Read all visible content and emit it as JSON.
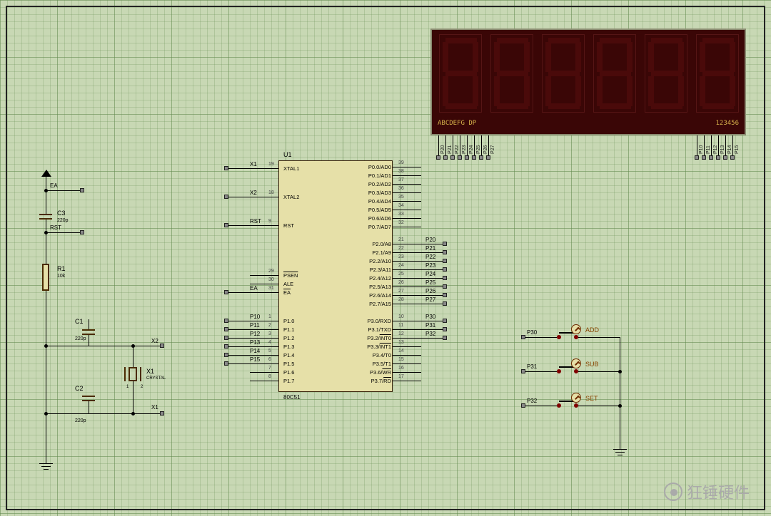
{
  "watermark": "狂锤硬件",
  "ic": {
    "ref": "U1",
    "part": "80C51",
    "pins_left": [
      {
        "n": "19",
        "name": "XTAL1",
        "net": "X1"
      },
      {
        "n": "18",
        "name": "XTAL2",
        "net": "X2"
      },
      {
        "n": "9",
        "name": "RST",
        "net": "RST"
      },
      {
        "n": "29",
        "name": "PSEN",
        "ov": true
      },
      {
        "n": "30",
        "name": "ALE"
      },
      {
        "n": "31",
        "name": "EA",
        "ov": true,
        "net": "EA"
      },
      {
        "n": "1",
        "name": "P1.0",
        "net": "P10"
      },
      {
        "n": "2",
        "name": "P1.1",
        "net": "P11"
      },
      {
        "n": "3",
        "name": "P1.2",
        "net": "P12"
      },
      {
        "n": "4",
        "name": "P1.3",
        "net": "P13"
      },
      {
        "n": "5",
        "name": "P1.4",
        "net": "P14"
      },
      {
        "n": "6",
        "name": "P1.5",
        "net": "P15"
      },
      {
        "n": "7",
        "name": "P1.6"
      },
      {
        "n": "8",
        "name": "P1.7"
      }
    ],
    "pins_right": [
      {
        "n": "39",
        "name": "P0.0/AD0"
      },
      {
        "n": "38",
        "name": "P0.1/AD1"
      },
      {
        "n": "37",
        "name": "P0.2/AD2"
      },
      {
        "n": "36",
        "name": "P0.3/AD3"
      },
      {
        "n": "35",
        "name": "P0.4/AD4"
      },
      {
        "n": "34",
        "name": "P0.5/AD5"
      },
      {
        "n": "33",
        "name": "P0.6/AD6"
      },
      {
        "n": "32",
        "name": "P0.7/AD7"
      },
      {
        "n": "21",
        "name": "P2.0/A8",
        "net": "P20"
      },
      {
        "n": "22",
        "name": "P2.1/A9",
        "net": "P21"
      },
      {
        "n": "23",
        "name": "P2.2/A10",
        "net": "P22"
      },
      {
        "n": "24",
        "name": "P2.3/A11",
        "net": "P23"
      },
      {
        "n": "25",
        "name": "P2.4/A12",
        "net": "P24"
      },
      {
        "n": "26",
        "name": "P2.5/A13",
        "net": "P25"
      },
      {
        "n": "27",
        "name": "P2.6/A14",
        "net": "P26"
      },
      {
        "n": "28",
        "name": "P2.7/A15",
        "net": "P27"
      },
      {
        "n": "10",
        "name": "P3.0/RXD",
        "net": "P30"
      },
      {
        "n": "11",
        "name": "P3.1/TXD",
        "net": "P31"
      },
      {
        "n": "12",
        "name": "P3.2/INT0",
        "ov2": true,
        "net": "P32"
      },
      {
        "n": "13",
        "name": "P3.3/INT1",
        "ov2": true
      },
      {
        "n": "14",
        "name": "P3.4/T0"
      },
      {
        "n": "15",
        "name": "P3.5/T1"
      },
      {
        "n": "16",
        "name": "P3.6/WR",
        "ov2": true
      },
      {
        "n": "17",
        "name": "P3.7/RD",
        "ov2": true
      }
    ]
  },
  "display": {
    "label_left": "ABCDEFG DP",
    "label_right": "123456",
    "segment_pins": [
      "P20",
      "P21",
      "P22",
      "P23",
      "P24",
      "P25",
      "P26",
      "P27"
    ],
    "digit_pins": [
      "P10",
      "P11",
      "P12",
      "P13",
      "P14",
      "P15"
    ]
  },
  "buttons": [
    {
      "net": "P30",
      "label": "ADD"
    },
    {
      "net": "P31",
      "label": "SUB"
    },
    {
      "net": "P32",
      "label": "SET"
    }
  ],
  "components": {
    "C3": {
      "ref": "C3",
      "val": "220p"
    },
    "C1": {
      "ref": "C1",
      "val": "220p"
    },
    "C2": {
      "ref": "C2",
      "val": "220p"
    },
    "R1": {
      "ref": "R1",
      "val": "10k"
    },
    "X1": {
      "ref": "X1",
      "val": "CRYSTAL"
    }
  },
  "netlabels": {
    "EA": "EA",
    "RST": "RST",
    "X1": "X1",
    "X2": "X2"
  },
  "xtalpins": {
    "p1": "1",
    "p2": "2"
  }
}
